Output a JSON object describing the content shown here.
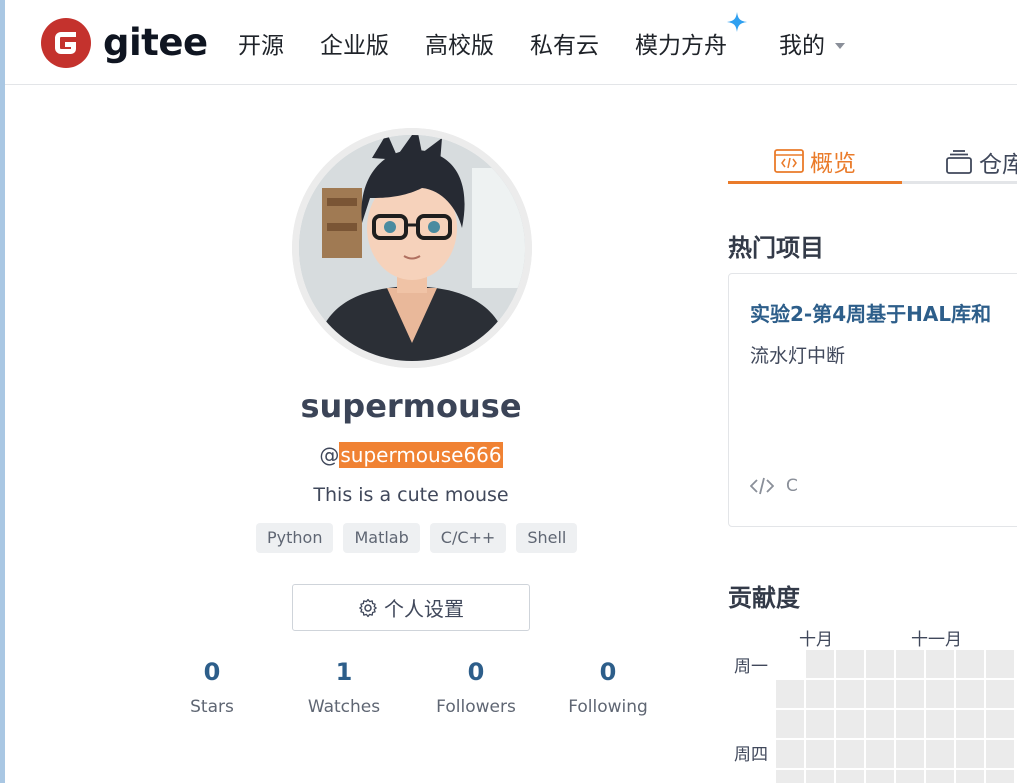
{
  "header": {
    "logo_text": "gitee",
    "nav": [
      {
        "label": "开源"
      },
      {
        "label": "企业版"
      },
      {
        "label": "高校版"
      },
      {
        "label": "私有云"
      },
      {
        "label": "模力方舟"
      },
      {
        "label": "我的"
      }
    ]
  },
  "profile": {
    "name": "supermouse",
    "handle_prefix": "@",
    "handle": "supermouse666",
    "bio": "This is a cute mouse",
    "tags": [
      "Python",
      "Matlab",
      "C/C++",
      "Shell"
    ],
    "settings_label": "个人设置",
    "stats": [
      {
        "value": "0",
        "label": "Stars"
      },
      {
        "value": "1",
        "label": "Watches"
      },
      {
        "value": "0",
        "label": "Followers"
      },
      {
        "value": "0",
        "label": "Following"
      }
    ]
  },
  "tabs": {
    "overview": "概览",
    "repos": "仓库"
  },
  "popular": {
    "title": "热门项目",
    "project": {
      "name": "实验2-第4周基于HAL库和",
      "description": "流水灯中断",
      "language": "C"
    }
  },
  "contrib": {
    "title": "贡献度",
    "months": [
      "十月",
      "十一月"
    ],
    "days": [
      "周一",
      "周四"
    ]
  },
  "colors": {
    "accent": "#ea7b2a",
    "link": "#2d5e8a",
    "logo_red": "#c4322d"
  }
}
